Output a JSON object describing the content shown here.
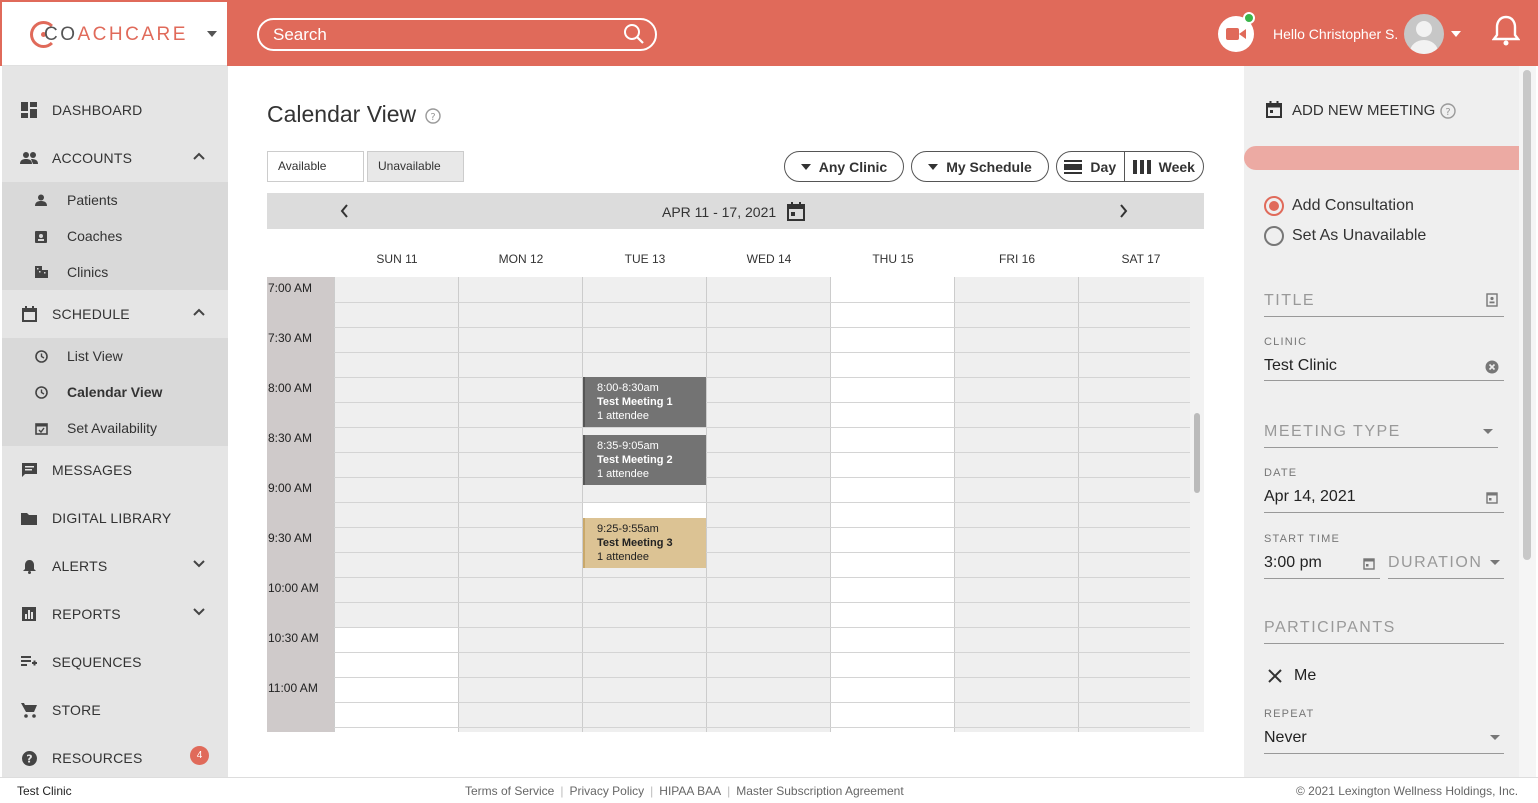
{
  "header": {
    "logo_text": "CO",
    "logo_text_b": "ACHCARE",
    "search_placeholder": "Search",
    "greeting": "Hello Christopher S."
  },
  "sidebar": {
    "dashboard": "DASHBOARD",
    "accounts": "ACCOUNTS",
    "patients": "Patients",
    "coaches": "Coaches",
    "clinics": "Clinics",
    "schedule": "SCHEDULE",
    "list_view": "List View",
    "calendar_view": "Calendar View",
    "set_availability": "Set Availability",
    "messages": "MESSAGES",
    "digital_library": "DIGITAL LIBRARY",
    "alerts": "ALERTS",
    "reports": "REPORTS",
    "sequences": "SEQUENCES",
    "store": "STORE",
    "resources": "RESOURCES",
    "resources_badge": "4"
  },
  "main": {
    "title": "Calendar View",
    "available": "Available",
    "unavailable": "Unavailable",
    "any_clinic": "Any Clinic",
    "my_schedule": "My Schedule",
    "day": "Day",
    "week": "Week",
    "week_range": "APR 11 - 17, 2021",
    "days": [
      "SUN 11",
      "MON 12",
      "TUE 13",
      "WED 14",
      "THU 15",
      "FRI 16",
      "SAT 17"
    ],
    "times": [
      "7:00 AM",
      "7:30 AM",
      "8:00 AM",
      "8:30 AM",
      "9:00 AM",
      "9:30 AM",
      "10:00 AM",
      "10:30 AM",
      "11:00 AM"
    ],
    "events": [
      {
        "time": "8:00-8:30am",
        "title": "Test Meeting 1",
        "attendees": "1 attendee"
      },
      {
        "time": "8:35-9:05am",
        "title": "Test Meeting 2",
        "attendees": "1 attendee"
      },
      {
        "time": "9:25-9:55am",
        "title": "Test Meeting 3",
        "attendees": "1 attendee"
      }
    ]
  },
  "panel": {
    "heading": "ADD NEW MEETING",
    "add_consultation": "Add Consultation",
    "set_unavailable": "Set As Unavailable",
    "title_placeholder": "TITLE",
    "clinic_label": "CLINIC",
    "clinic_value": "Test Clinic",
    "meeting_type_placeholder": "MEETING TYPE",
    "date_label": "DATE",
    "date_value": "Apr 14, 2021",
    "start_time_label": "START TIME",
    "start_time_value": "3:00 pm",
    "duration_placeholder": "DURATION",
    "participants_placeholder": "PARTICIPANTS",
    "participant_me": "Me",
    "repeat_label": "REPEAT",
    "repeat_value": "Never"
  },
  "footer": {
    "clinic": "Test Clinic",
    "terms": "Terms of Service",
    "privacy": "Privacy Policy",
    "hipaa": "HIPAA BAA",
    "msa": "Master Subscription Agreement",
    "sep": "|",
    "copyright": "© 2021 Lexington Wellness Holdings, Inc."
  },
  "colors": {
    "brand": "#e06a5a",
    "event_dark": "#737373",
    "event_tan": "#dcc394"
  }
}
